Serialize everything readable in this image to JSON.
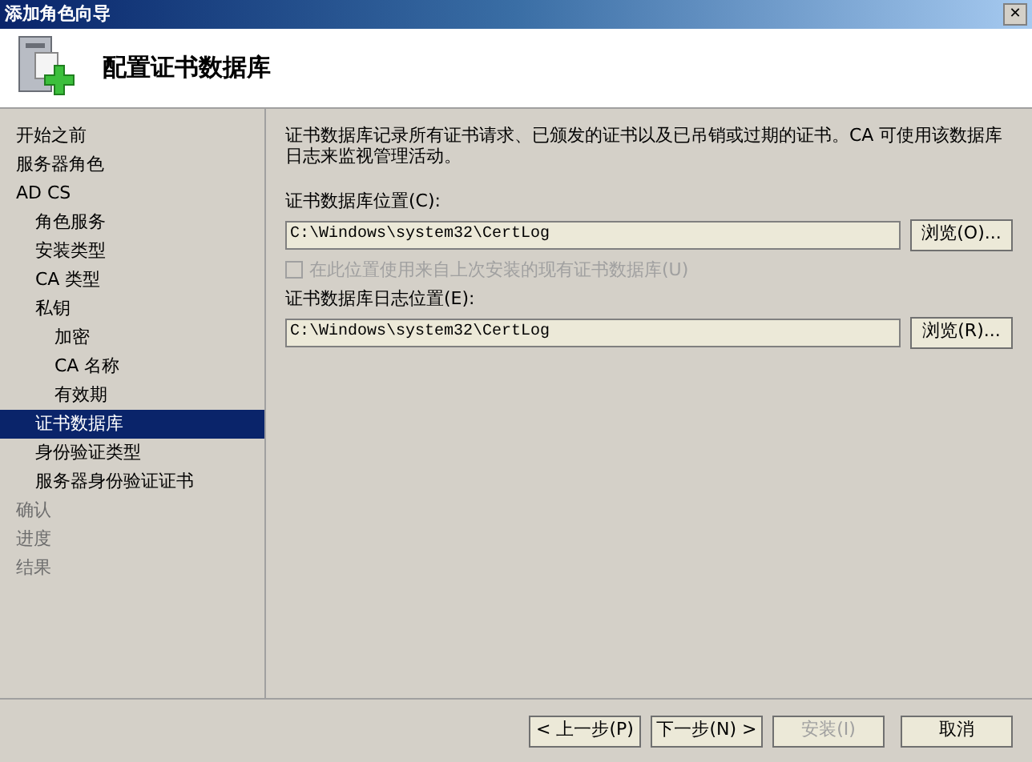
{
  "window": {
    "title": "添加角色向导",
    "close": "✕"
  },
  "header": {
    "title": "配置证书数据库"
  },
  "sidebar": {
    "items": [
      {
        "label": "开始之前",
        "selected": false,
        "disabled": false
      },
      {
        "label": "服务器角色",
        "selected": false,
        "disabled": false
      },
      {
        "label": "AD CS",
        "selected": false,
        "disabled": false,
        "children": [
          {
            "label": "角色服务",
            "selected": false,
            "disabled": false
          },
          {
            "label": "安装类型",
            "selected": false,
            "disabled": false
          },
          {
            "label": "CA 类型",
            "selected": false,
            "disabled": false
          },
          {
            "label": "私钥",
            "selected": false,
            "disabled": false,
            "children": [
              {
                "label": "加密",
                "selected": false,
                "disabled": false
              },
              {
                "label": "CA 名称",
                "selected": false,
                "disabled": false
              },
              {
                "label": "有效期",
                "selected": false,
                "disabled": false
              }
            ]
          },
          {
            "label": "证书数据库",
            "selected": true,
            "disabled": false
          },
          {
            "label": "身份验证类型",
            "selected": false,
            "disabled": false
          },
          {
            "label": "服务器身份验证证书",
            "selected": false,
            "disabled": false
          }
        ]
      },
      {
        "label": "确认",
        "selected": false,
        "disabled": true
      },
      {
        "label": "进度",
        "selected": false,
        "disabled": true
      },
      {
        "label": "结果",
        "selected": false,
        "disabled": true
      }
    ]
  },
  "content": {
    "description": "证书数据库记录所有证书请求、已颁发的证书以及已吊销或过期的证书。CA 可使用该数据库日志来监视管理活动。",
    "database_location": {
      "label": "证书数据库位置(C):",
      "value": "C:\\Windows\\system32\\CertLog",
      "browse": "浏览(O)..."
    },
    "reuse_checkbox": {
      "label": "在此位置使用来自上次安装的现有证书数据库(U)",
      "checked": false,
      "disabled": true
    },
    "log_location": {
      "label": "证书数据库日志位置(E):",
      "value": "C:\\Windows\\system32\\CertLog",
      "browse": "浏览(R)..."
    }
  },
  "buttons": [
    {
      "label": "< 上一步(P)",
      "disabled": false
    },
    {
      "label": "下一步(N) >",
      "disabled": false
    },
    {
      "label": "安装(I)",
      "disabled": true
    },
    {
      "label": "取消",
      "disabled": false
    }
  ]
}
